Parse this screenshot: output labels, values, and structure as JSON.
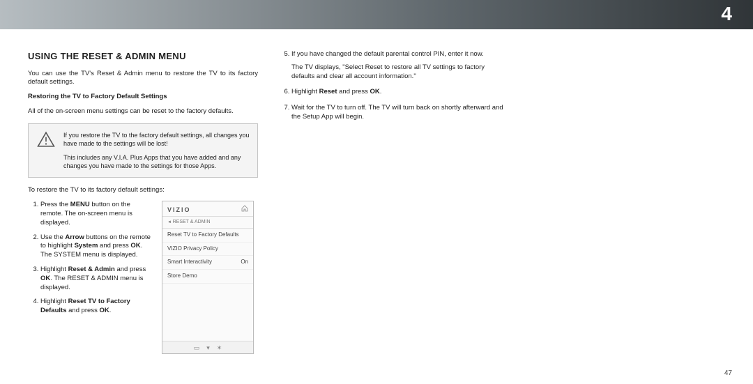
{
  "header": {
    "chapter_number": "4"
  },
  "page_number": "47",
  "col1": {
    "heading": "USING THE RESET & ADMIN MENU",
    "intro": "You can use the TV's Reset & Admin menu to restore the TV to its factory default settings.",
    "subhead": "Restoring the TV to Factory Default Settings",
    "subtext": "All of the on-screen menu settings can be reset to the factory defaults.",
    "warning": {
      "para1": "If you restore the TV to the factory default settings, all changes you have made to the settings will be lost!",
      "para2": "This includes any V.I.A. Plus Apps that you have added and any changes you have made to the settings for those Apps."
    },
    "restore_intro": "To restore the TV to its factory default settings:",
    "steps": {
      "s1a": "Press the ",
      "s1b": "MENU",
      "s1c": " button on the remote. The on-screen menu is displayed.",
      "s2a": "Use the ",
      "s2b": "Arrow",
      "s2c": " buttons on the remote to highlight ",
      "s2d": "System",
      "s2e": " and press ",
      "s2f": "OK",
      "s2g": ". The SYSTEM menu is displayed.",
      "s3a": "Highlight ",
      "s3b": "Reset & Admin",
      "s3c": " and press ",
      "s3d": "OK",
      "s3e": ". The RESET & ADMIN menu is displayed.",
      "s4a": "Highlight ",
      "s4b": "Reset TV to Factory Defaults",
      "s4c": " and press ",
      "s4d": "OK",
      "s4e": "."
    },
    "tv_menu": {
      "brand": "VIZIO",
      "crumb": "RESET & ADMIN",
      "rows": [
        {
          "label": "Reset TV to Factory Defaults",
          "value": ""
        },
        {
          "label": "VIZIO Privacy Policy",
          "value": ""
        },
        {
          "label": "Smart Interactivity",
          "value": "On"
        },
        {
          "label": "Store Demo",
          "value": ""
        }
      ]
    }
  },
  "col2": {
    "s5a": "If you have changed the default parental control PIN, enter it now.",
    "s5b": "The TV displays, \"Select Reset to restore all TV settings to factory defaults and clear all account information.\"",
    "s6a": "Highlight ",
    "s6b": "Reset",
    "s6c": " and press ",
    "s6d": "OK",
    "s6e": ".",
    "s7": "Wait for the TV to turn off. The TV will turn back on shortly afterward and the Setup App will begin."
  }
}
